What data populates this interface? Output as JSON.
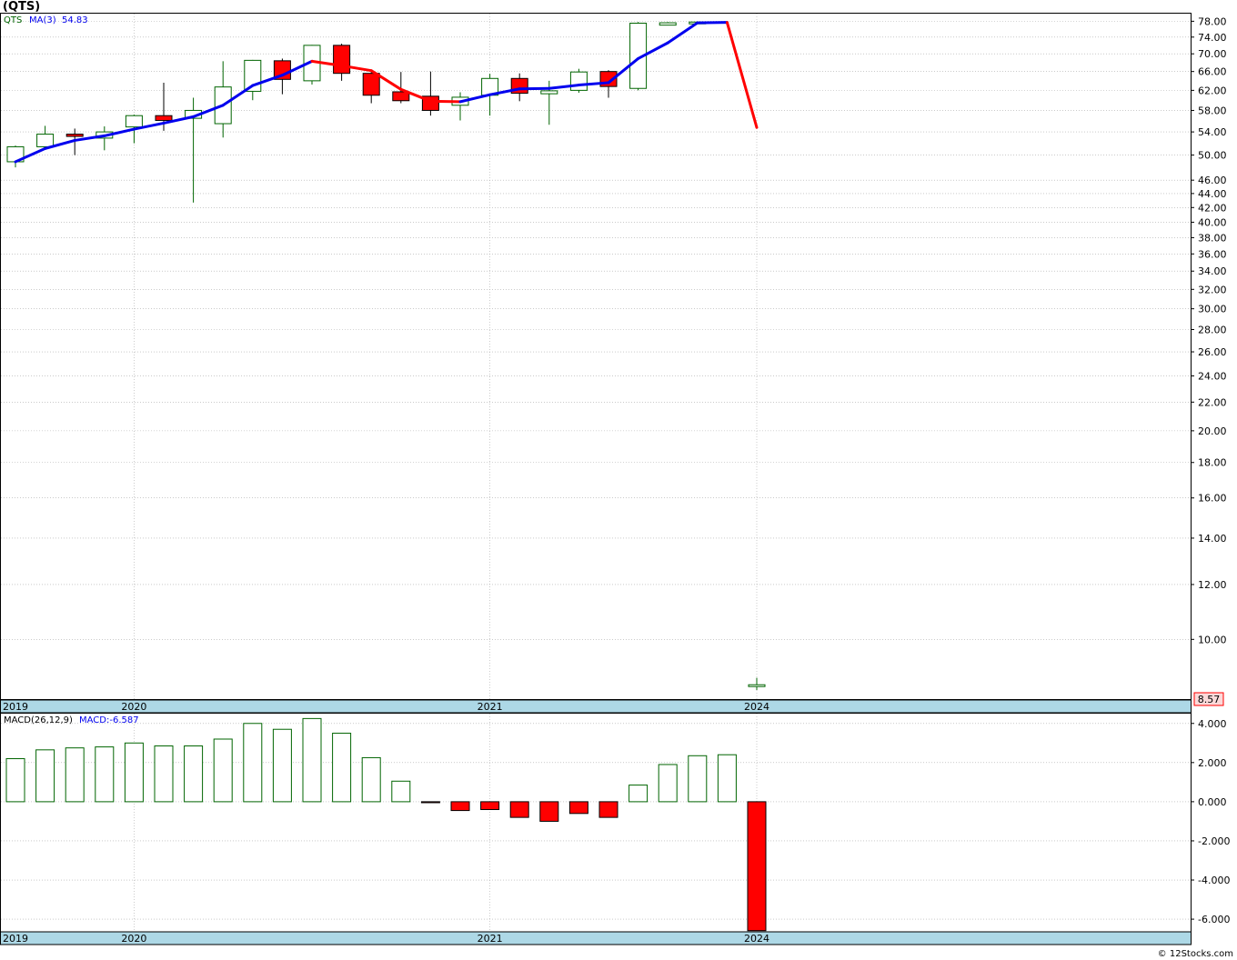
{
  "title": "(QTS)",
  "credit": "© 12Stocks.com",
  "colors": {
    "up": "#006400",
    "down": "#ff0000",
    "ma_up": "#0000ee",
    "ma_down": "#ff0000",
    "axis_band": "#add8e6",
    "grid": "#aaaaaa",
    "price_box": "#fbd9d9"
  },
  "chart_data": [
    {
      "type": "candlestick",
      "scale": "log",
      "ylim": [
        8.2,
        80
      ],
      "legend": {
        "symbol": "QTS",
        "ma_label": "MA(3)",
        "ma_value": "54.83"
      },
      "last_price": "8.57",
      "y_ticks": [
        "78.00",
        "74.00",
        "70.00",
        "66.00",
        "62.00",
        "58.00",
        "54.00",
        "50.00",
        "46.00",
        "44.00",
        "42.00",
        "40.00",
        "38.00",
        "36.00",
        "34.00",
        "32.00",
        "30.00",
        "28.00",
        "26.00",
        "24.00",
        "22.00",
        "20.00",
        "18.00",
        "16.00",
        "14.00",
        "12.00",
        "10.00"
      ],
      "x_labels": [
        {
          "label": "2019",
          "index": -0.55
        },
        {
          "label": "2020",
          "index": 4.0
        },
        {
          "label": "2021",
          "index": 16.0
        },
        {
          "label": "2024",
          "index": 25.0
        }
      ],
      "candles": [
        {
          "open": 48.9,
          "high": 51.6,
          "low": 48.0,
          "close": 51.4
        },
        {
          "open": 51.4,
          "high": 55.1,
          "low": 50.9,
          "close": 53.6
        },
        {
          "open": 53.6,
          "high": 54.6,
          "low": 50.0,
          "close": 53.2
        },
        {
          "open": 52.9,
          "high": 55.0,
          "low": 50.8,
          "close": 54.0
        },
        {
          "open": 54.9,
          "high": 57.2,
          "low": 52.0,
          "close": 57.0
        },
        {
          "open": 57.0,
          "high": 63.6,
          "low": 54.2,
          "close": 56.1
        },
        {
          "open": 56.5,
          "high": 60.5,
          "low": 42.7,
          "close": 58.0
        },
        {
          "open": 55.5,
          "high": 68.3,
          "low": 53.0,
          "close": 62.7
        },
        {
          "open": 61.8,
          "high": 68.6,
          "low": 60.0,
          "close": 68.5
        },
        {
          "open": 68.4,
          "high": 68.9,
          "low": 61.2,
          "close": 64.3
        },
        {
          "open": 64.0,
          "high": 72.1,
          "low": 63.2,
          "close": 72.0
        },
        {
          "open": 72.0,
          "high": 72.4,
          "low": 64.0,
          "close": 65.6
        },
        {
          "open": 65.6,
          "high": 66.4,
          "low": 59.4,
          "close": 61.0
        },
        {
          "open": 61.7,
          "high": 65.9,
          "low": 59.4,
          "close": 59.9
        },
        {
          "open": 60.8,
          "high": 66.0,
          "low": 57.0,
          "close": 58.0
        },
        {
          "open": 59.0,
          "high": 61.6,
          "low": 56.1,
          "close": 60.6
        },
        {
          "open": 61.0,
          "high": 65.5,
          "low": 57.0,
          "close": 64.5
        },
        {
          "open": 64.5,
          "high": 65.6,
          "low": 59.8,
          "close": 61.4
        },
        {
          "open": 61.3,
          "high": 64.0,
          "low": 55.3,
          "close": 61.9
        },
        {
          "open": 62.0,
          "high": 66.6,
          "low": 61.5,
          "close": 65.9
        },
        {
          "open": 66.0,
          "high": 66.3,
          "low": 60.5,
          "close": 62.8
        },
        {
          "open": 62.4,
          "high": 77.8,
          "low": 62.0,
          "close": 77.5
        },
        {
          "open": 77.0,
          "high": 77.8,
          "low": 77.0,
          "close": 77.6
        },
        {
          "open": 77.7,
          "high": 77.9,
          "low": 77.6,
          "close": 77.8
        },
        null,
        {
          "open": 8.55,
          "high": 8.8,
          "low": 8.45,
          "close": 8.6
        }
      ],
      "ma3": [
        48.9,
        51.1,
        52.5,
        53.3,
        54.5,
        55.6,
        56.8,
        59.0,
        63.0,
        65.2,
        68.3,
        67.3,
        66.2,
        62.2,
        59.8,
        59.7,
        61.1,
        62.3,
        62.4,
        63.1,
        63.6,
        68.9,
        72.6,
        77.6,
        77.7,
        54.8
      ],
      "ma3_colors": [
        "up",
        "up",
        "up",
        "up",
        "up",
        "up",
        "up",
        "up",
        "up",
        "up",
        "down",
        "down",
        "down",
        "down",
        "down",
        "up",
        "up",
        "up",
        "up",
        "up",
        "up",
        "up",
        "up",
        "up",
        "down"
      ]
    },
    {
      "type": "bar",
      "legend": {
        "name": "MACD(26,12,9)",
        "value_label": "MACD:-6.587"
      },
      "ylim": [
        -6.6,
        4.5
      ],
      "y_ticks": [
        4.0,
        2.0,
        0.0,
        -2.0,
        -4.0,
        -6.0
      ],
      "y_tick_labels": [
        "4.000",
        "2.000",
        "0.000",
        "-2.000",
        "-4.000",
        "-6.000"
      ],
      "x_labels": [
        {
          "label": "2019",
          "index": -0.55
        },
        {
          "label": "2020",
          "index": 4.0
        },
        {
          "label": "2021",
          "index": 16.0
        },
        {
          "label": "2024",
          "index": 25.0
        }
      ],
      "values": [
        2.2,
        2.65,
        2.75,
        2.8,
        3.0,
        2.85,
        2.85,
        3.2,
        4.0,
        3.7,
        4.25,
        3.5,
        2.25,
        1.05,
        -0.05,
        -0.45,
        -0.4,
        -0.8,
        -1.0,
        -0.6,
        -0.8,
        0.85,
        1.9,
        2.35,
        2.4,
        -6.587
      ]
    }
  ]
}
